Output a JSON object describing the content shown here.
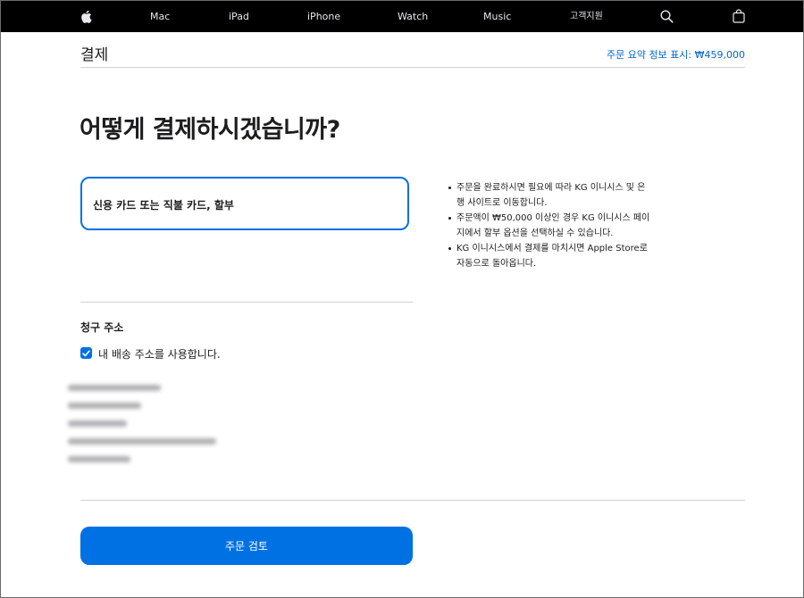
{
  "nav": {
    "items": [
      "Mac",
      "iPad",
      "iPhone",
      "Watch",
      "Music",
      "고객지원"
    ],
    "icons": [
      "apple-logo",
      "search-icon",
      "bag-icon"
    ]
  },
  "header": {
    "title": "결제",
    "summary_link": "주문 요약 정보 표시: ₩459,000"
  },
  "main": {
    "heading": "어떻게 결제하시겠습니까?",
    "payment_option": "신용 카드 또는 직불 카드, 할부",
    "notes": [
      "주문을 완료하시면 필요에 따라 KG 이니시스 및 은행 사이트로 이동합니다.",
      "주문액이 ₩50,000 이상인 경우 KG 이니시스 페이지에서 할부 옵션을 선택하실 수 있습니다.",
      "KG 이니시스에서 결제를 마치시면 Apple Store로 자동으로 돌아옵니다."
    ]
  },
  "billing": {
    "heading": "청구 주소",
    "use_shipping_label": "내 배송 주소를 사용합니다.",
    "use_shipping_checked": true
  },
  "actions": {
    "review_button": "주문 검토"
  },
  "colors": {
    "accent": "#0071e3",
    "link": "#0066cc",
    "nav_bg": "#000000"
  }
}
